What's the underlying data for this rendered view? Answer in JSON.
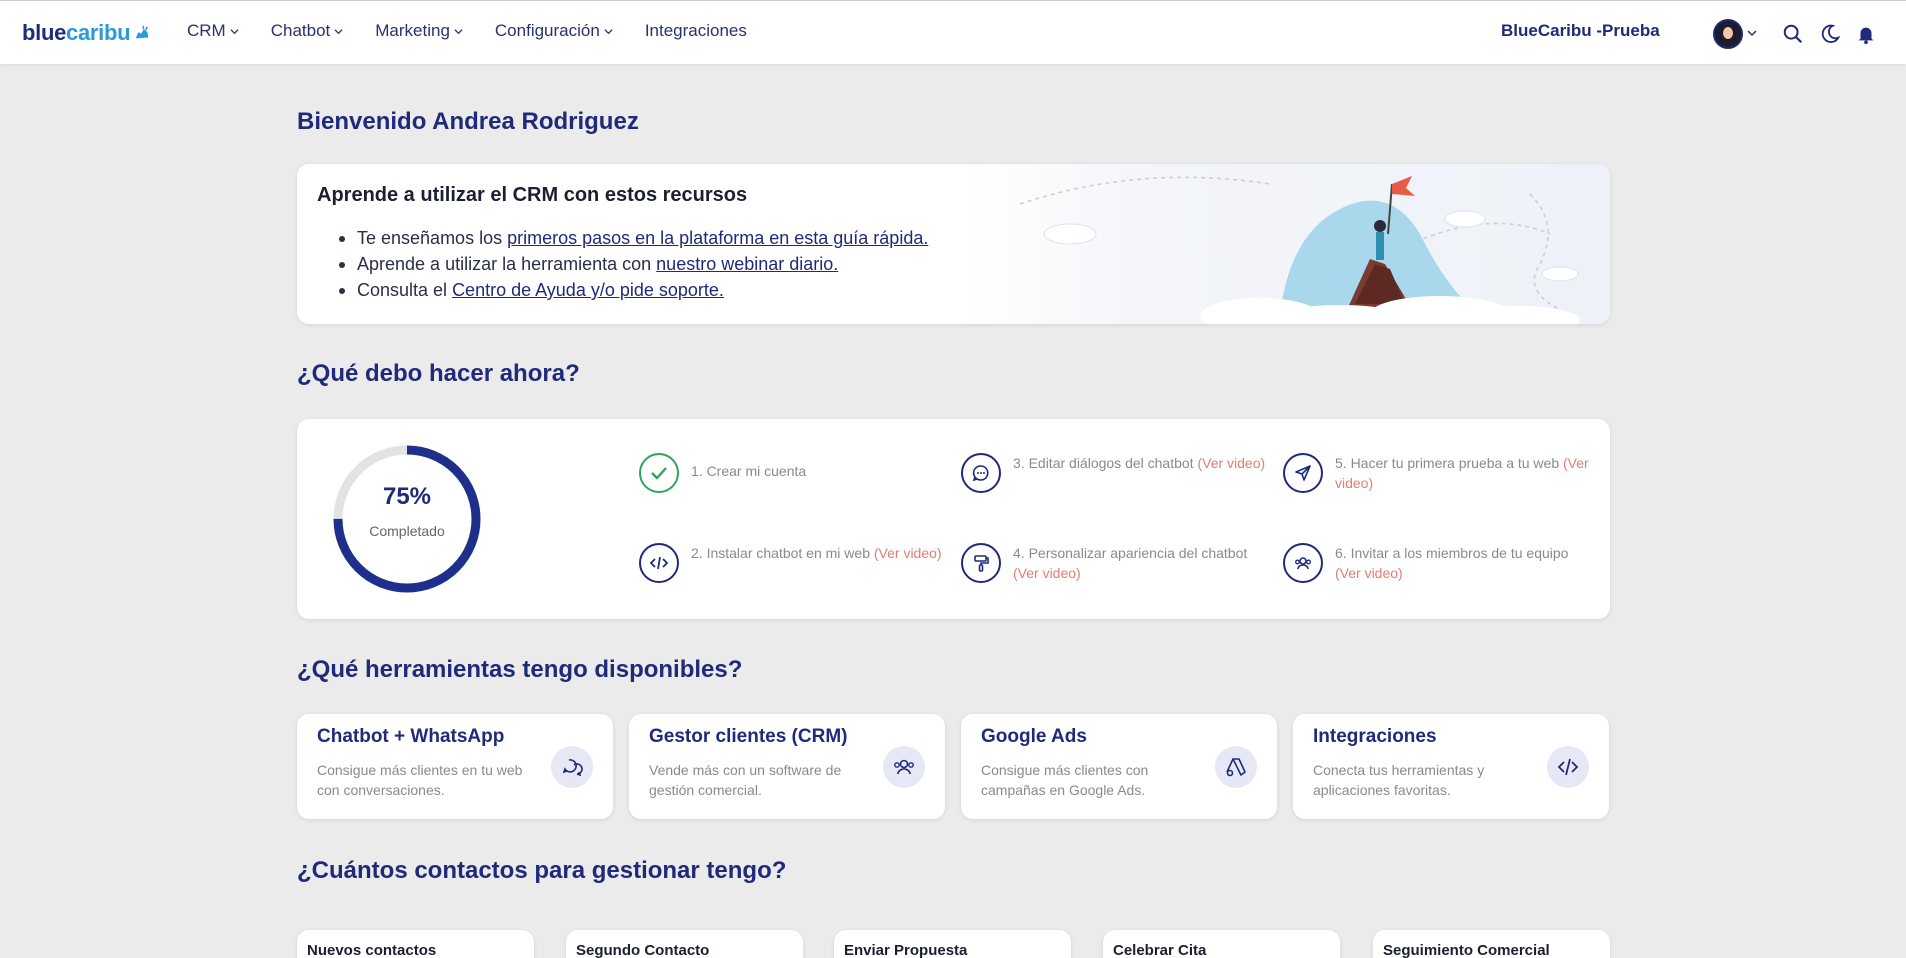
{
  "header": {
    "logo_part1": "blue",
    "logo_part2": "caribu",
    "nav": [
      {
        "label": "CRM",
        "has_dropdown": true
      },
      {
        "label": "Chatbot",
        "has_dropdown": true
      },
      {
        "label": "Marketing",
        "has_dropdown": true
      },
      {
        "label": "Configuración",
        "has_dropdown": true
      },
      {
        "label": "Integraciones",
        "has_dropdown": false
      }
    ],
    "account_name": "BlueCaribu -Prueba",
    "icons": [
      "search-icon",
      "dark-mode-moon-icon",
      "notifications-bell-icon"
    ]
  },
  "welcome": "Bienvenido Andrea Rodriguez",
  "resources": {
    "title": "Aprende a utilizar el CRM con estos recursos",
    "items": [
      {
        "prefix": "Te enseñamos los ",
        "link": "primeros pasos en la plataforma en esta guía rápida."
      },
      {
        "prefix": "Aprende a utilizar la herramienta con ",
        "link": "nuestro webinar diario."
      },
      {
        "prefix": "Consulta el ",
        "link": "Centro de Ayuda y/o pide soporte."
      }
    ]
  },
  "steps_section": {
    "title": "¿Qué debo hacer ahora?",
    "progress_value": 75,
    "progress_text": "75%",
    "progress_label": "Completado",
    "steps": [
      {
        "text": "1. Crear mi cuenta",
        "video": "",
        "icon": "check-icon",
        "done": true
      },
      {
        "text": "2. Instalar chatbot en mi web ",
        "video": "(Ver video)",
        "icon": "code-icon",
        "done": false
      },
      {
        "text": "3. Editar diálogos del chatbot ",
        "video": "(Ver video)",
        "icon": "chat-bubble-icon",
        "done": false
      },
      {
        "text": "4. Personalizar apariencia del chatbot ",
        "video": "(Ver video)",
        "icon": "paint-roller-icon",
        "done": false
      },
      {
        "text": "5. Hacer tu primera prueba a tu web ",
        "video": "(Ver video)",
        "icon": "send-icon",
        "done": false
      },
      {
        "text": "6. Invitar a los miembros de tu equipo ",
        "video": "(Ver video)",
        "icon": "team-icon",
        "done": false
      }
    ]
  },
  "tools_section": {
    "title": "¿Qué herramientas tengo disponibles?",
    "tools": [
      {
        "title": "Chatbot + WhatsApp",
        "desc": "Consigue más clientes en tu web con conversaciones.",
        "icon": "chat-icon"
      },
      {
        "title": "Gestor clientes (CRM)",
        "desc": "Vende más con un software de gestión comercial.",
        "icon": "users-icon"
      },
      {
        "title": "Google Ads",
        "desc": "Consigue más clientes con campañas en Google Ads.",
        "icon": "google-ads-icon"
      },
      {
        "title": "Integraciones",
        "desc": "Conecta tus herramientas y aplicaciones favoritas.",
        "icon": "code-icon"
      }
    ]
  },
  "contacts_section": {
    "title": "¿Cuántos contactos para gestionar tengo?",
    "stages": [
      "Nuevos contactos",
      "Segundo Contacto",
      "Enviar Propuesta",
      "Celebrar Cita",
      "Seguimiento Comercial"
    ]
  },
  "colors": {
    "primary": "#1f2a7a",
    "accent": "#2a9ad8",
    "success": "#2ea55a",
    "video_link": "#e27d72",
    "background": "#ebebeb"
  }
}
